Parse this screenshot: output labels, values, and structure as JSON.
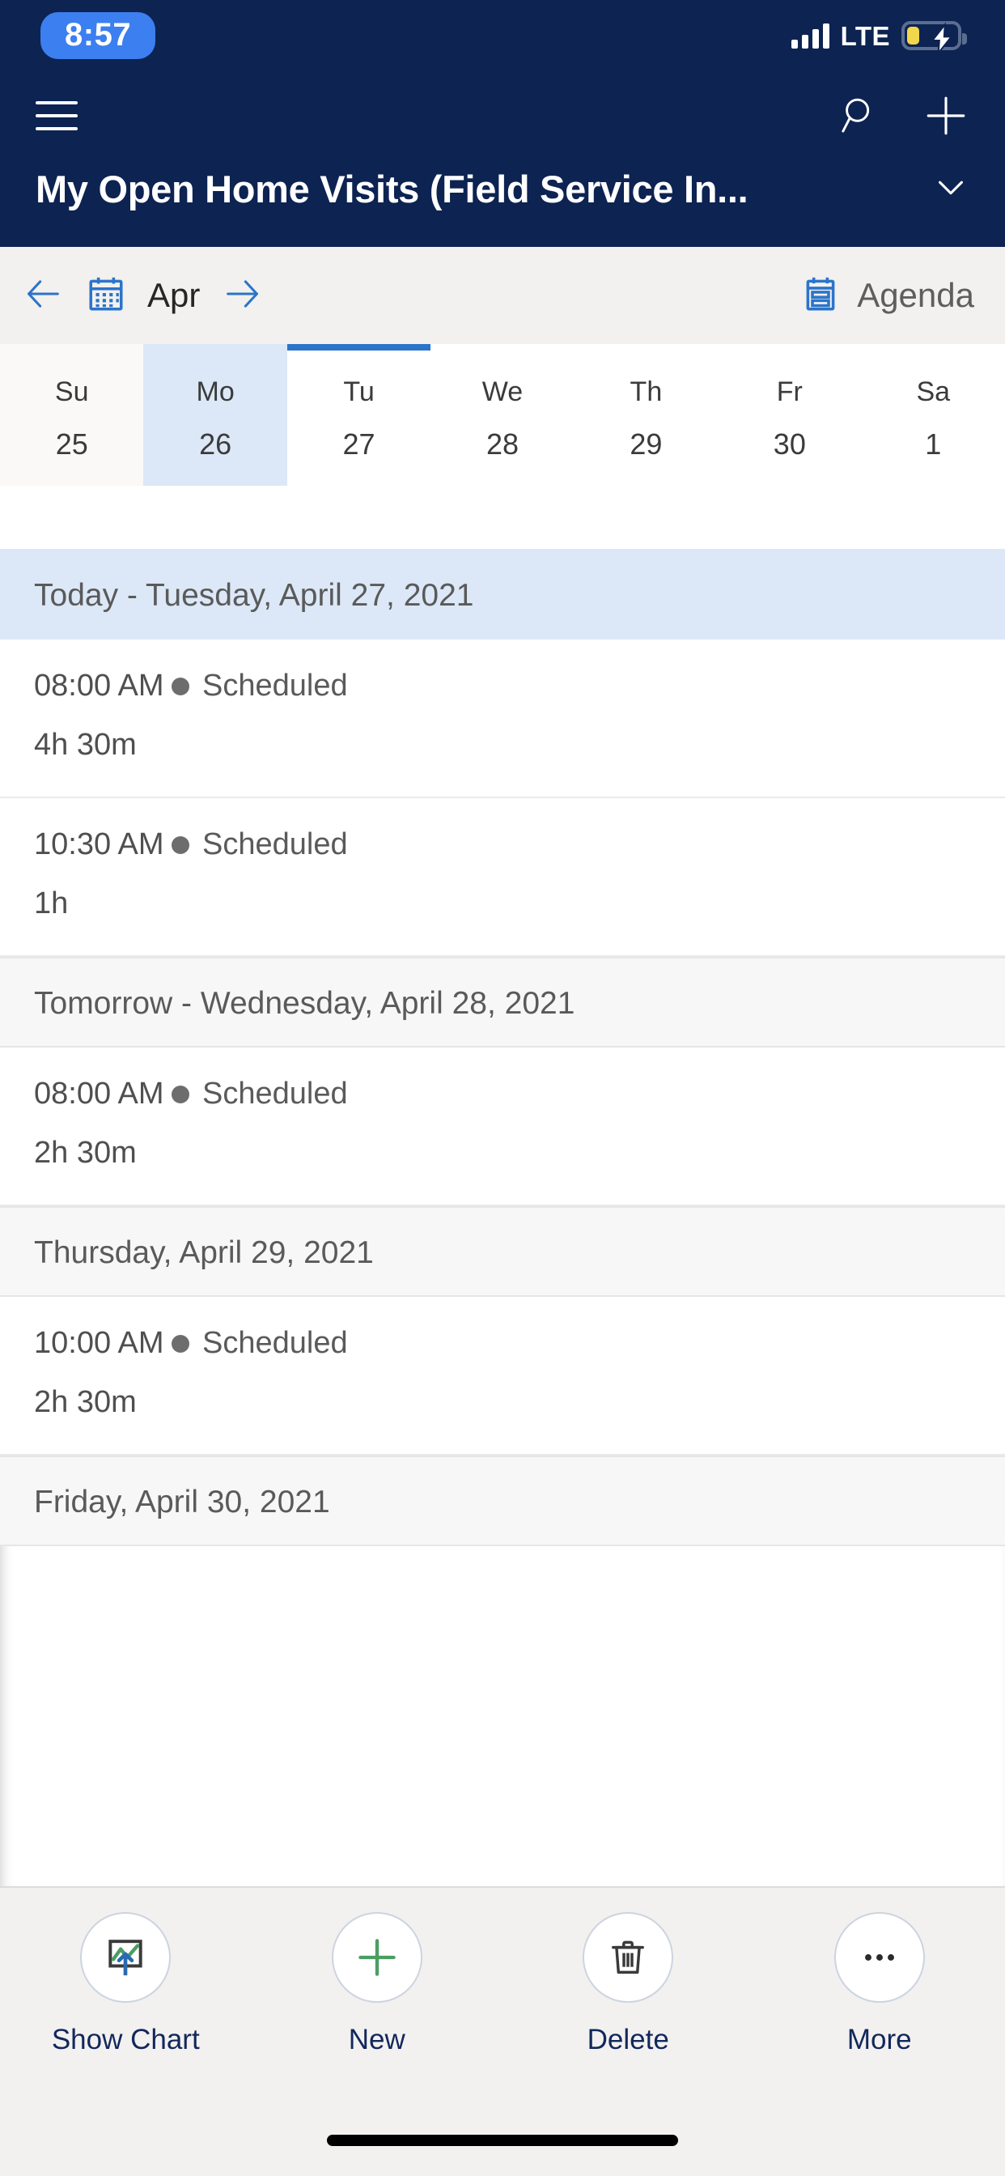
{
  "status_bar": {
    "time": "8:57",
    "network": "LTE",
    "signal_icon": "signal-bars-icon",
    "battery_icon": "battery-charging-icon",
    "accent_pill_color": "#3b7ff0",
    "battery_fill_color": "#f2d64b"
  },
  "header": {
    "background_color": "#0d2352",
    "menu_icon": "hamburger-menu-icon",
    "search_icon": "search-icon",
    "new_icon": "plus-icon",
    "title": "My Open Home Visits (Field Service In...",
    "title_chevron_icon": "chevron-down-icon"
  },
  "month_bar": {
    "prev_icon": "arrow-left-icon",
    "calendar_icon": "calendar-icon",
    "month": "Apr",
    "next_icon": "arrow-right-icon",
    "agenda_icon": "agenda-list-icon",
    "agenda_label": "Agenda",
    "accent_color": "#2b74ca"
  },
  "week_strip": {
    "days": [
      {
        "dow": "Su",
        "num": "25",
        "off_month": true,
        "selected": false,
        "today": false
      },
      {
        "dow": "Mo",
        "num": "26",
        "off_month": false,
        "selected": true,
        "today": false
      },
      {
        "dow": "Tu",
        "num": "27",
        "off_month": false,
        "selected": false,
        "today": true
      },
      {
        "dow": "We",
        "num": "28",
        "off_month": false,
        "selected": false,
        "today": false
      },
      {
        "dow": "Th",
        "num": "29",
        "off_month": false,
        "selected": false,
        "today": false
      },
      {
        "dow": "Fr",
        "num": "30",
        "off_month": false,
        "selected": false,
        "today": false
      },
      {
        "dow": "Sa",
        "num": "1",
        "off_month": false,
        "selected": false,
        "today": false
      }
    ]
  },
  "agenda": {
    "sections": [
      {
        "title": "Today - Tuesday, April 27, 2021",
        "is_today": true,
        "appointments": [
          {
            "time": "08:00 AM",
            "status": "Scheduled",
            "duration": "4h 30m"
          },
          {
            "time": "10:30 AM",
            "status": "Scheduled",
            "duration": "1h"
          }
        ]
      },
      {
        "title": "Tomorrow - Wednesday, April 28, 2021",
        "is_today": false,
        "appointments": [
          {
            "time": "08:00 AM",
            "status": "Scheduled",
            "duration": "2h 30m"
          }
        ]
      },
      {
        "title": "Thursday, April 29, 2021",
        "is_today": false,
        "appointments": [
          {
            "time": "10:00 AM",
            "status": "Scheduled",
            "duration": "2h 30m"
          }
        ]
      },
      {
        "title": "Friday, April 30, 2021",
        "is_today": false,
        "appointments": []
      }
    ],
    "status_dot_color": "#6d6d6d"
  },
  "command_bar": {
    "commands": [
      {
        "label": "Show Chart",
        "icon": "chart-icon"
      },
      {
        "label": "New",
        "icon": "plus-icon"
      },
      {
        "label": "Delete",
        "icon": "trash-icon"
      },
      {
        "label": "More",
        "icon": "ellipsis-icon"
      }
    ],
    "label_color": "#12275c"
  }
}
